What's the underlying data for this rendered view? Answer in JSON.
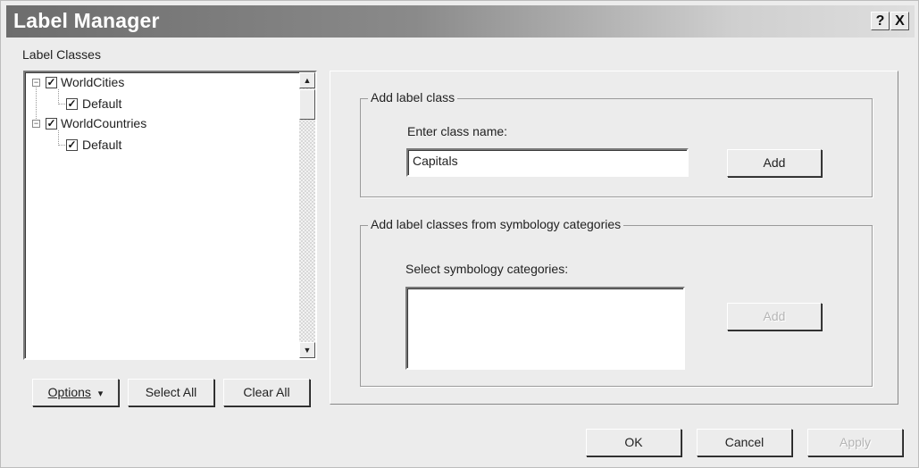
{
  "window": {
    "title": "Label Manager",
    "help_label": "?",
    "close_label": "X"
  },
  "tree_section": {
    "label": "Label Classes",
    "nodes": [
      {
        "label": "WorldCities",
        "expander": "−",
        "checked": true
      },
      {
        "label": "Default",
        "checked": true
      },
      {
        "label": "WorldCountries",
        "expander": "−",
        "checked": true
      },
      {
        "label": "Default",
        "checked": true
      }
    ],
    "check_mark": "✓",
    "scroll_up": "▲",
    "scroll_down": "▼"
  },
  "tree_buttons": {
    "options_label": "Options",
    "options_caret": "▾",
    "select_all_label": "Select All",
    "clear_all_label": "Clear All"
  },
  "add_class_group": {
    "legend": "Add label class",
    "prompt": "Enter class name:",
    "class_name_value": "Capitals",
    "add_label": "Add"
  },
  "symbology_group": {
    "legend": "Add label classes from symbology categories",
    "prompt": "Select symbology categories:",
    "add_label": "Add"
  },
  "footer": {
    "ok_label": "OK",
    "cancel_label": "Cancel",
    "apply_label": "Apply"
  }
}
